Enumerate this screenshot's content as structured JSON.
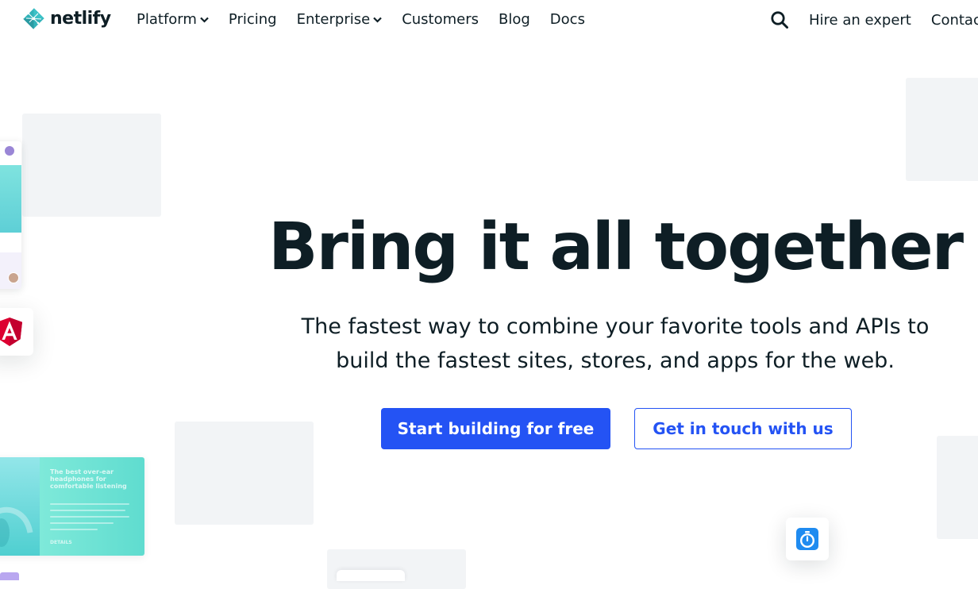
{
  "brand": {
    "name": "netlify",
    "logo_icon": "netlify-logo-icon",
    "color": "#32b3b9"
  },
  "nav": {
    "items": [
      {
        "label": "Platform",
        "has_dropdown": true
      },
      {
        "label": "Pricing",
        "has_dropdown": false
      },
      {
        "label": "Enterprise",
        "has_dropdown": true
      },
      {
        "label": "Customers",
        "has_dropdown": false
      },
      {
        "label": "Blog",
        "has_dropdown": false
      },
      {
        "label": "Docs",
        "has_dropdown": false
      }
    ],
    "search_icon": "search-icon",
    "right_items": [
      {
        "label": "Hire an expert"
      },
      {
        "label": "Contact"
      }
    ]
  },
  "hero": {
    "title": "Bring it all together",
    "subtitle": "The fastest way to combine your favorite tools and APIs to build the fastest sites, stores, and apps for the web.",
    "primary_cta": "Start building for free",
    "secondary_cta": "Get in touch with us"
  },
  "decor": {
    "product_card_headline": "The best over-ear headphones for comfortable listening",
    "product_card_footer": "DETAILS",
    "angular_icon": "angular-logo-icon",
    "timer_icon": "stopwatch-icon"
  },
  "colors": {
    "accent": "#2453f4",
    "text": "#0e1e25",
    "placeholder": "#f2f4f6",
    "teal": "#5ecfd6"
  }
}
